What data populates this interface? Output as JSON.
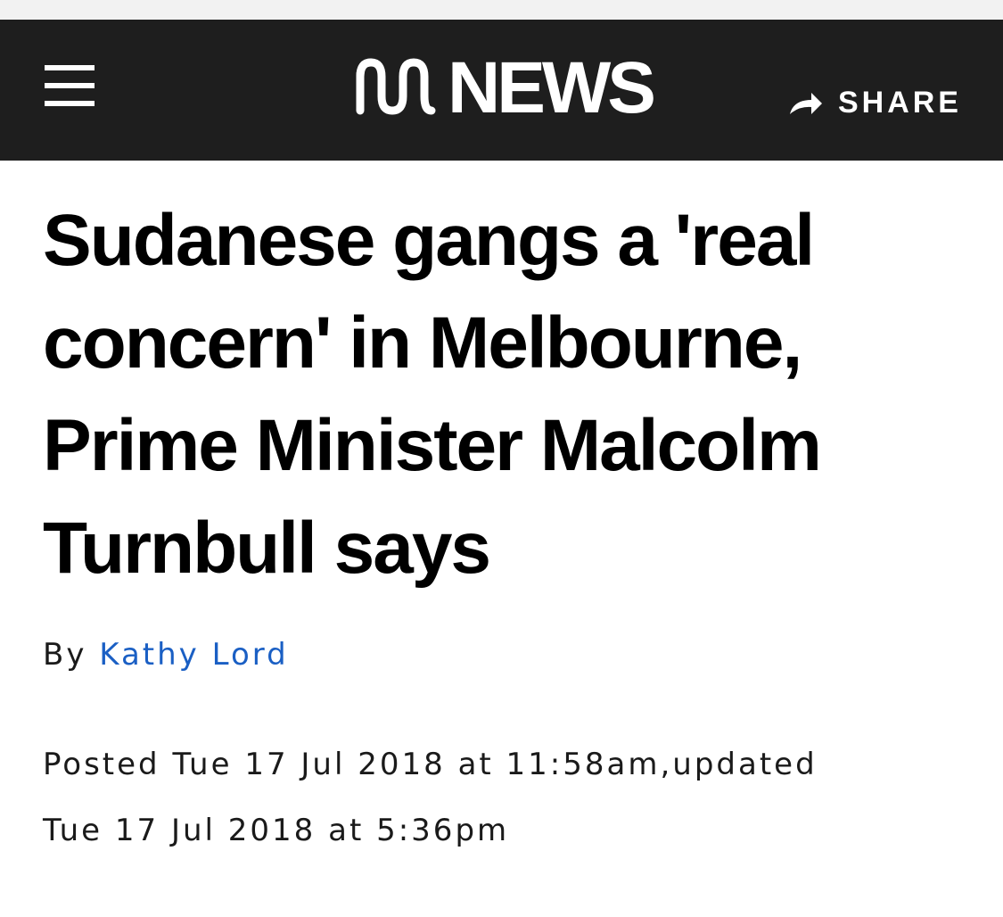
{
  "header": {
    "menu_icon": "hamburger-menu-icon",
    "logo_text": "NEWS",
    "logo_icon": "abc-ribbon-logo-icon",
    "share_icon": "share-arrow-icon",
    "share_label": "SHARE",
    "background_color": "#1e1e1e"
  },
  "article": {
    "headline": "Sudanese gangs a 'real concern' in Melbourne, Prime Minister Malcolm Turnbull says",
    "byline": {
      "prefix": "By",
      "author": "Kathy Lord",
      "author_color": "#1a5fc4"
    },
    "posted": {
      "posted_label": "Posted",
      "posted_date": "Tue 17 Jul 2018 at 11:58am,",
      "updated_label": "updated",
      "updated_date": "Tue 17 Jul 2018 at 5:36pm"
    }
  }
}
